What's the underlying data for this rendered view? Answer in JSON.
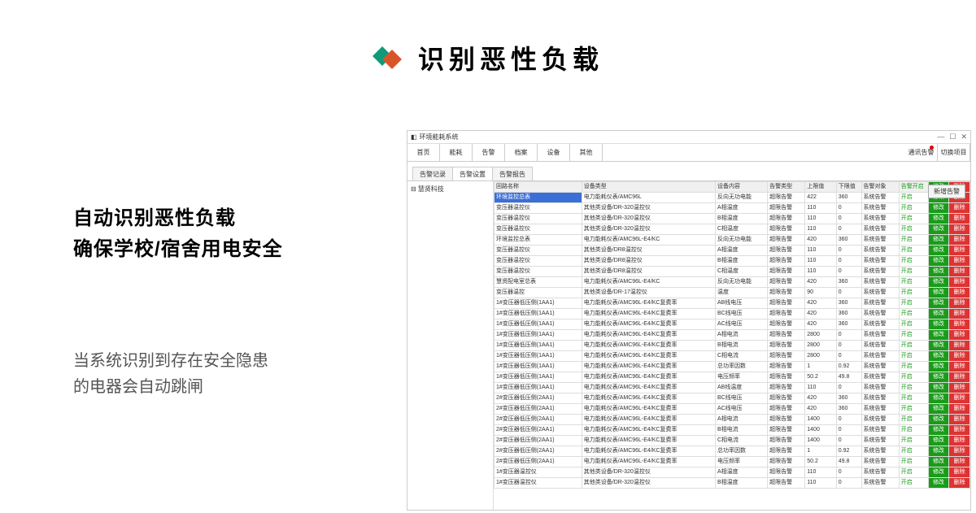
{
  "hero": {
    "title": "识别恶性负载"
  },
  "left": {
    "line1": "自动识别恶性负载",
    "line2": "确保学校/宿舍用电安全",
    "desc1": "当系统识别到存在安全隐患",
    "desc2": "的电器会自动跳闸"
  },
  "app": {
    "title": "环境能耗系统",
    "menu": [
      "首页",
      "能耗",
      "告警",
      "档案",
      "设备",
      "其他"
    ],
    "menu_right": [
      "通讯告警",
      "切换项目"
    ],
    "tabs": [
      "告警记录",
      "告警设置",
      "告警报告"
    ],
    "tree_root": "慧贤科技",
    "right_btn": "新增告警",
    "cols": [
      "回路名称",
      "设备类型",
      "设备内容",
      "告警类型",
      "上限值",
      "下限值",
      "告警对象",
      "告警开启",
      "修改",
      "删除"
    ],
    "en_label": "开启",
    "mod_label": "修改",
    "del_label": "删除",
    "rows": [
      {
        "name": "环境监控总表",
        "dev": "电力能耗仪表/AMC96L",
        "cont": "反向无功电能",
        "type": "超限告警",
        "up": "422",
        "lo": "360",
        "obj": "系统告警",
        "sel": true
      },
      {
        "name": "变压器温控仪",
        "dev": "其他类设备/DR-320温控仪",
        "cont": "A相温度",
        "type": "超限告警",
        "up": "110",
        "lo": "0",
        "obj": "系统告警"
      },
      {
        "name": "变压器温控仪",
        "dev": "其他类设备/DR-320温控仪",
        "cont": "B相温度",
        "type": "超限告警",
        "up": "110",
        "lo": "0",
        "obj": "系统告警"
      },
      {
        "name": "变压器温控仪",
        "dev": "其他类设备/DR-320温控仪",
        "cont": "C相温度",
        "type": "超限告警",
        "up": "110",
        "lo": "0",
        "obj": "系统告警"
      },
      {
        "name": "环境监控总表",
        "dev": "电力能耗仪表/AMC96L-E4/KC",
        "cont": "反向无功电能",
        "type": "超限告警",
        "up": "420",
        "lo": "360",
        "obj": "系统告警"
      },
      {
        "name": "变压器温控仪",
        "dev": "其他类设备/DR8温控仪",
        "cont": "A相温度",
        "type": "超限告警",
        "up": "110",
        "lo": "0",
        "obj": "系统告警"
      },
      {
        "name": "变压器温控仪",
        "dev": "其他类设备/DR8温控仪",
        "cont": "B相温度",
        "type": "超限告警",
        "up": "110",
        "lo": "0",
        "obj": "系统告警"
      },
      {
        "name": "变压器温控仪",
        "dev": "其他类设备/DR8温控仪",
        "cont": "C相温度",
        "type": "超限告警",
        "up": "110",
        "lo": "0",
        "obj": "系统告警"
      },
      {
        "name": "慧贤配电室总表",
        "dev": "电力能耗仪表/AMC96L-E4/KC",
        "cont": "反向无功电能",
        "type": "超限告警",
        "up": "420",
        "lo": "360",
        "obj": "系统告警"
      },
      {
        "name": "变压器温控",
        "dev": "其他类设备/DR-17温控仪",
        "cont": "温度",
        "type": "超限告警",
        "up": "90",
        "lo": "0",
        "obj": "系统告警"
      },
      {
        "name": "1#变压器低压侧(1AA1)",
        "dev": "电力能耗仪表/AMC96L-E4/KC复费率",
        "cont": "AB线电压",
        "type": "超限告警",
        "up": "420",
        "lo": "360",
        "obj": "系统告警"
      },
      {
        "name": "1#变压器低压侧(1AA1)",
        "dev": "电力能耗仪表/AMC96L-E4/KC复费率",
        "cont": "BC线电压",
        "type": "超限告警",
        "up": "420",
        "lo": "360",
        "obj": "系统告警"
      },
      {
        "name": "1#变压器低压侧(1AA1)",
        "dev": "电力能耗仪表/AMC96L-E4/KC复费率",
        "cont": "AC线电压",
        "type": "超限告警",
        "up": "420",
        "lo": "360",
        "obj": "系统告警"
      },
      {
        "name": "1#变压器低压侧(1AA1)",
        "dev": "电力能耗仪表/AMC96L-E4/KC复费率",
        "cont": "A相电流",
        "type": "超限告警",
        "up": "2800",
        "lo": "0",
        "obj": "系统告警"
      },
      {
        "name": "1#变压器低压侧(1AA1)",
        "dev": "电力能耗仪表/AMC96L-E4/KC复费率",
        "cont": "B相电流",
        "type": "超限告警",
        "up": "2800",
        "lo": "0",
        "obj": "系统告警"
      },
      {
        "name": "1#变压器低压侧(1AA1)",
        "dev": "电力能耗仪表/AMC96L-E4/KC复费率",
        "cont": "C相电流",
        "type": "超限告警",
        "up": "2800",
        "lo": "0",
        "obj": "系统告警"
      },
      {
        "name": "1#变压器低压侧(1AA1)",
        "dev": "电力能耗仪表/AMC96L-E4/KC复费率",
        "cont": "总功率因数",
        "type": "超限告警",
        "up": "1",
        "lo": "0.92",
        "obj": "系统告警"
      },
      {
        "name": "1#变压器低压侧(1AA1)",
        "dev": "电力能耗仪表/AMC96L-E4/KC复费率",
        "cont": "电压频率",
        "type": "超限告警",
        "up": "50.2",
        "lo": "49.8",
        "obj": "系统告警"
      },
      {
        "name": "1#变压器低压侧(1AA1)",
        "dev": "电力能耗仪表/AMC96L-E4/KC复费率",
        "cont": "AB线温度",
        "type": "超限告警",
        "up": "110",
        "lo": "0",
        "obj": "系统告警"
      },
      {
        "name": "2#变压器低压侧(2AA1)",
        "dev": "电力能耗仪表/AMC96L-E4/KC复费率",
        "cont": "BC线电压",
        "type": "超限告警",
        "up": "420",
        "lo": "360",
        "obj": "系统告警"
      },
      {
        "name": "2#变压器低压侧(2AA1)",
        "dev": "电力能耗仪表/AMC96L-E4/KC复费率",
        "cont": "AC线电压",
        "type": "超限告警",
        "up": "420",
        "lo": "360",
        "obj": "系统告警"
      },
      {
        "name": "2#变压器低压侧(2AA1)",
        "dev": "电力能耗仪表/AMC96L-E4/KC复费率",
        "cont": "A相电流",
        "type": "超限告警",
        "up": "1400",
        "lo": "0",
        "obj": "系统告警"
      },
      {
        "name": "2#变压器低压侧(2AA1)",
        "dev": "电力能耗仪表/AMC96L-E4/KC复费率",
        "cont": "B相电流",
        "type": "超限告警",
        "up": "1400",
        "lo": "0",
        "obj": "系统告警"
      },
      {
        "name": "2#变压器低压侧(2AA1)",
        "dev": "电力能耗仪表/AMC96L-E4/KC复费率",
        "cont": "C相电流",
        "type": "超限告警",
        "up": "1400",
        "lo": "0",
        "obj": "系统告警"
      },
      {
        "name": "2#变压器低压侧(2AA1)",
        "dev": "电力能耗仪表/AMC96L-E4/KC复费率",
        "cont": "总功率因数",
        "type": "超限告警",
        "up": "1",
        "lo": "0.92",
        "obj": "系统告警"
      },
      {
        "name": "2#变压器低压侧(2AA1)",
        "dev": "电力能耗仪表/AMC96L-E4/KC复费率",
        "cont": "电压频率",
        "type": "超限告警",
        "up": "50.2",
        "lo": "49.8",
        "obj": "系统告警"
      },
      {
        "name": "1#变压器温控仪",
        "dev": "其他类设备/DR-320温控仪",
        "cont": "A相温度",
        "type": "超限告警",
        "up": "110",
        "lo": "0",
        "obj": "系统告警"
      },
      {
        "name": "1#变压器温控仪",
        "dev": "其他类设备/DR-320温控仪",
        "cont": "B相温度",
        "type": "超限告警",
        "up": "110",
        "lo": "0",
        "obj": "系统告警"
      }
    ]
  }
}
